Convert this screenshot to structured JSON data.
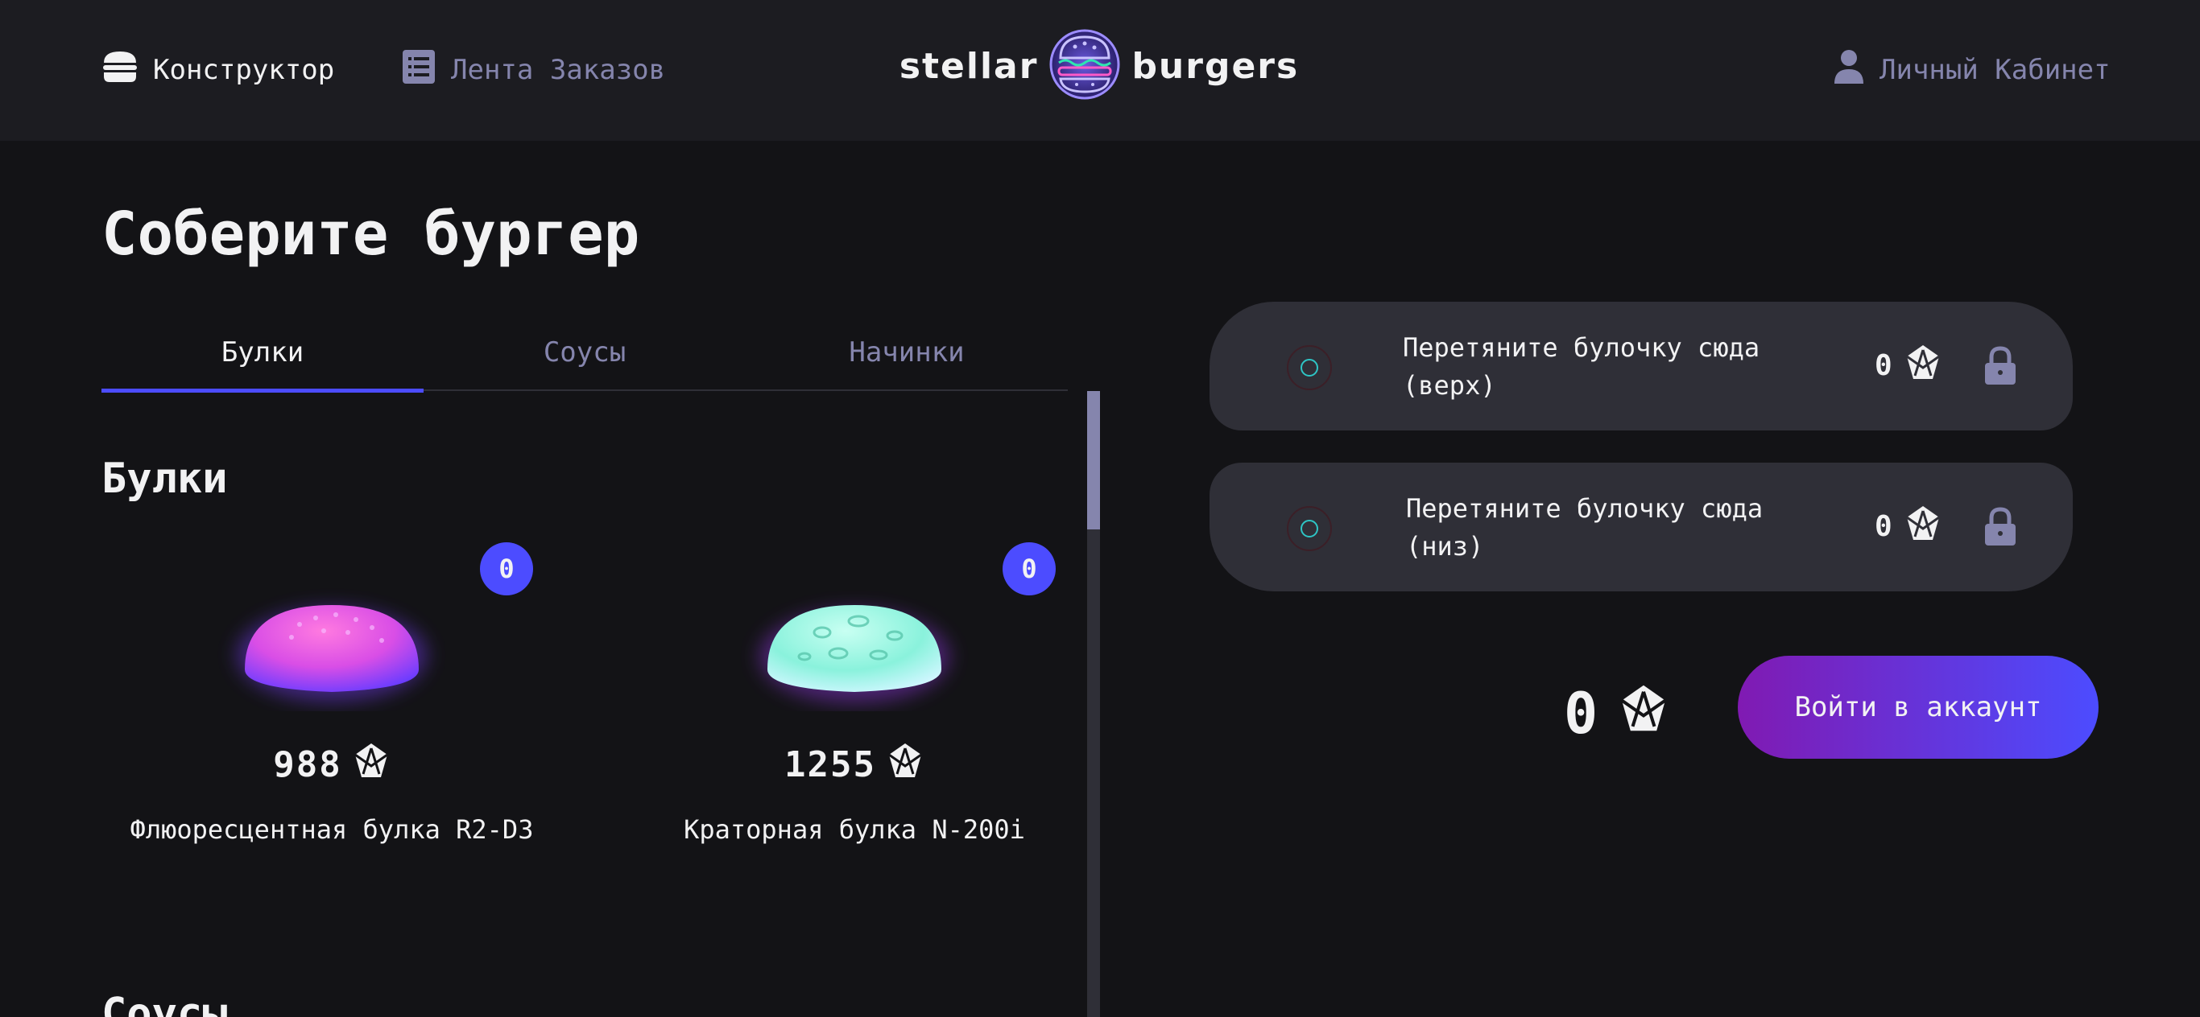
{
  "header": {
    "nav_constructor": "Конструктор",
    "nav_feed": "Лента Заказов",
    "nav_account": "Личный Кабинет",
    "logo_left": "stellar",
    "logo_right": "burgers"
  },
  "page_title": "Соберите бургер",
  "tabs": [
    {
      "label": "Булки",
      "active": true
    },
    {
      "label": "Соусы",
      "active": false
    },
    {
      "label": "Начинки",
      "active": false
    }
  ],
  "sections": {
    "buns": "Булки",
    "sauces": "Соусы"
  },
  "ingredients": [
    {
      "name": "Флюоресцентная булка R2-D3",
      "price": "988",
      "count": "0",
      "icon": "pink-bun"
    },
    {
      "name": "Краторная булка N-200i",
      "price": "1255",
      "count": "0",
      "icon": "mint-bun"
    }
  ],
  "burger": {
    "top": {
      "text": "Перетяните булочку сюда (верх)",
      "price": "0"
    },
    "bottom": {
      "text": "Перетяните булочку сюда (низ)",
      "price": "0"
    },
    "total": "0",
    "login_button": "Войти в аккаунт"
  },
  "colors": {
    "accent": "#4c4cff",
    "background": "#131316",
    "panel": "#2f2f37",
    "inactive_text": "#8585ad"
  }
}
